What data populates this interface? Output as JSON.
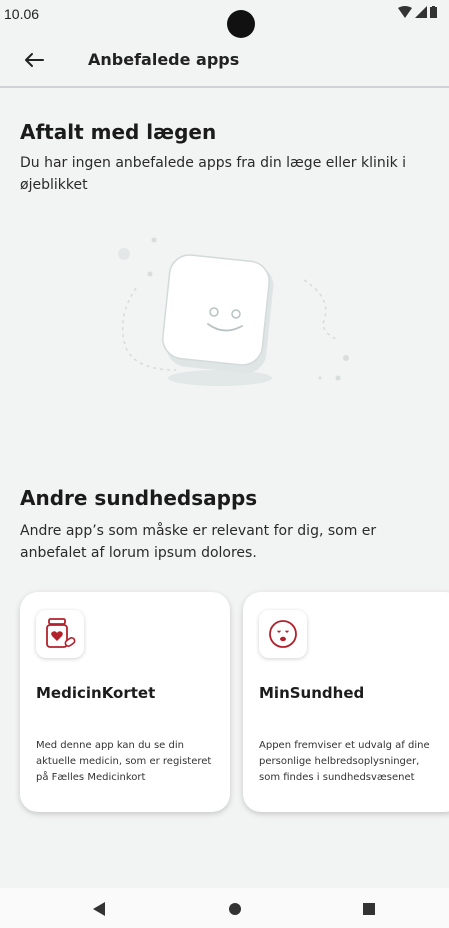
{
  "status_bar": {
    "time": "10.06"
  },
  "header": {
    "title": "Anbefalede apps"
  },
  "agreed_section": {
    "title": "Aftalt med lægen",
    "description": "Du har ingen anbefalede apps fra din læge eller klinik i øjeblikket"
  },
  "other_section": {
    "title": "Andre sundhedsapps",
    "description": "Andre app’s som måske er relevant for dig, som er anbefalet af lorum ipsum dolores."
  },
  "apps": [
    {
      "name": "MedicinKortet",
      "description": "Med denne app kan du se din aktuelle medicin, som er registeret på Fælles Medicinkort",
      "icon": "medicine-bottle-icon"
    },
    {
      "name": "MinSundhed",
      "description": "Appen fremviser et udvalg af dine personlige helbredsoplysninger, som findes i sundhedsvæsenet",
      "icon": "smiley-face-icon"
    }
  ],
  "colors": {
    "accent": "#b3222b",
    "background": "#f2f3f3"
  }
}
